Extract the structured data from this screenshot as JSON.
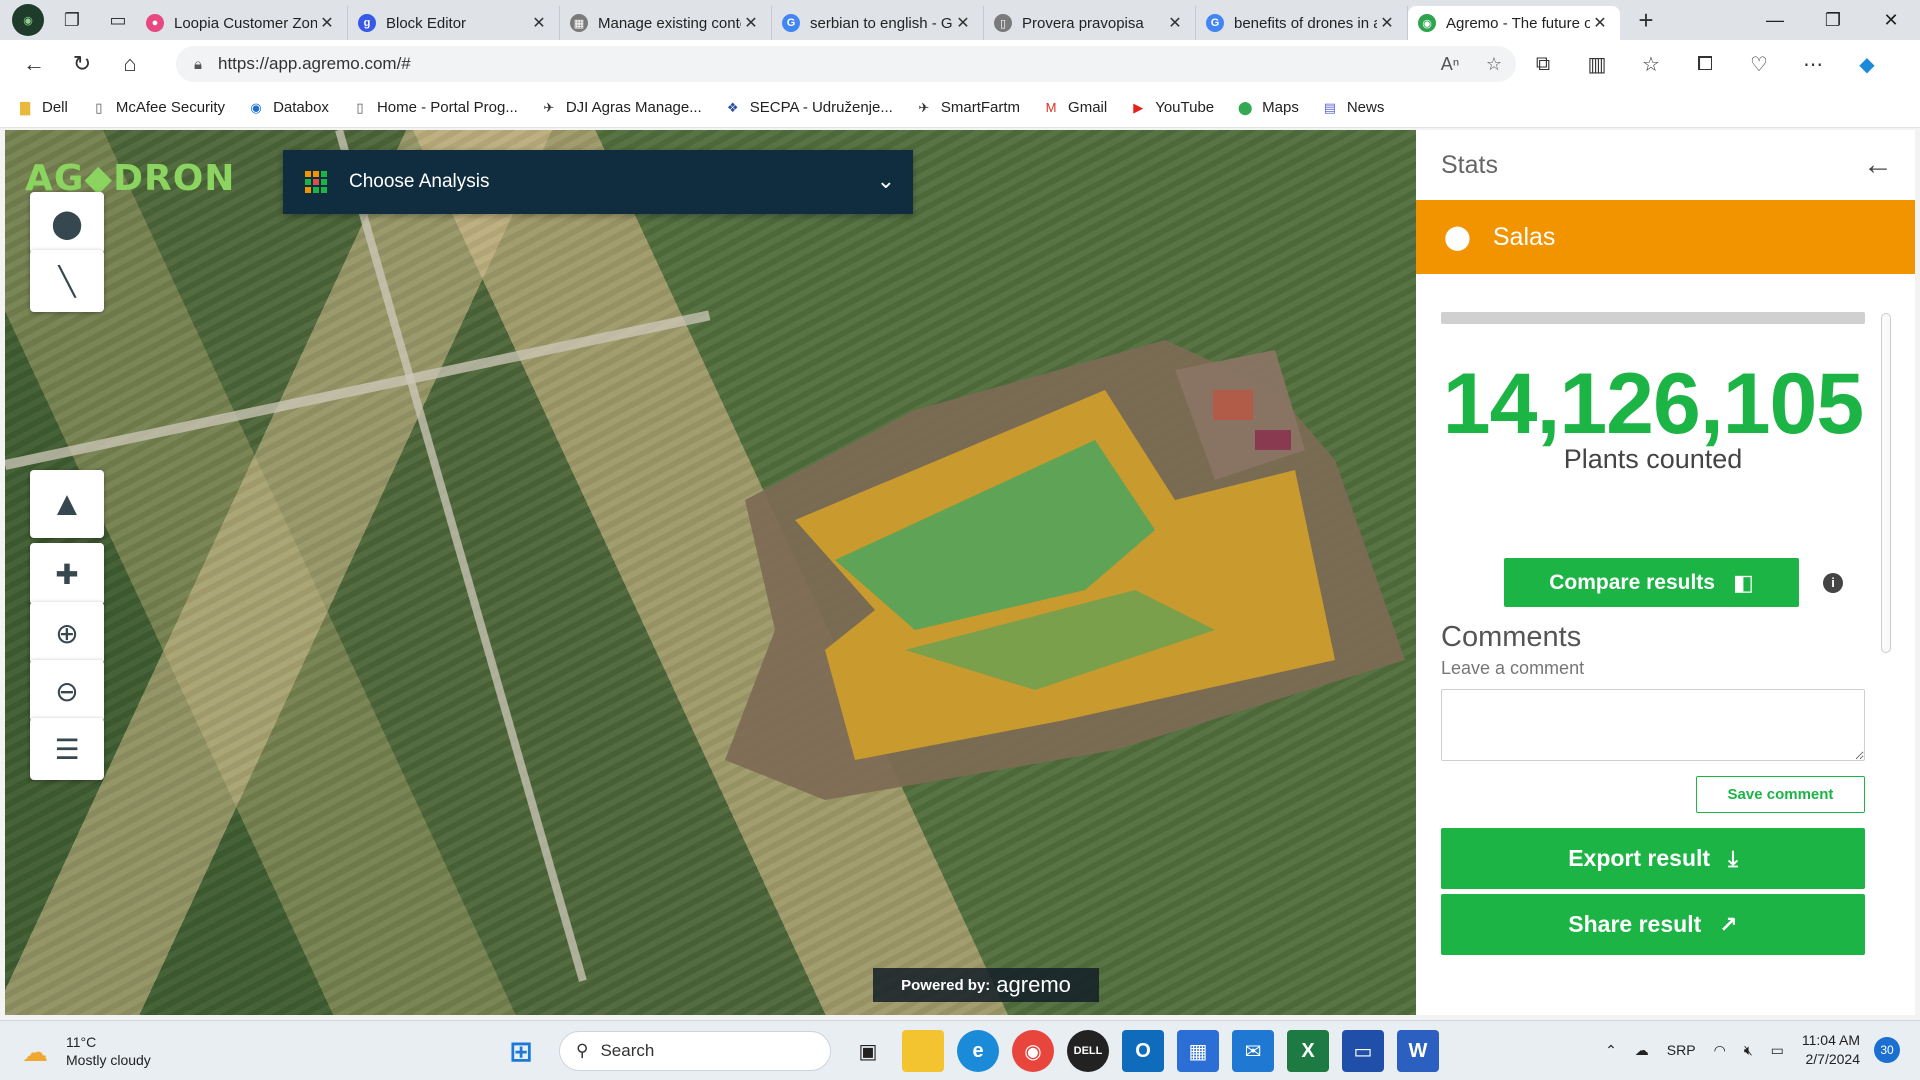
{
  "browser": {
    "tabs": [
      {
        "title": "Loopia Customer Zone",
        "color": "#e64980",
        "glyph": "●"
      },
      {
        "title": "Block Editor",
        "color": "#3858e9",
        "glyph": "g"
      },
      {
        "title": "Manage existing content",
        "color": "#7a7a7a",
        "glyph": "▦"
      },
      {
        "title": "serbian to english - Google Search",
        "color": "#4285f4",
        "glyph": "G"
      },
      {
        "title": "Provera pravopisa",
        "color": "#7a7a7a",
        "glyph": "▯"
      },
      {
        "title": "benefits of drones in agriculture",
        "color": "#4285f4",
        "glyph": "G"
      },
      {
        "title": "Agremo - The future of agriculture",
        "color": "#2ea44f",
        "glyph": "◉"
      }
    ],
    "url": "https://app.agremo.com/#",
    "bookmarks": [
      {
        "label": "Dell",
        "icon": "folder-icon"
      },
      {
        "label": "McAfee Security",
        "icon": "page-icon"
      },
      {
        "label": "Databox",
        "icon": "databox-icon"
      },
      {
        "label": "Home - Portal Prog...",
        "icon": "page-icon"
      },
      {
        "label": "DJI Agras Manage...",
        "icon": "dji-icon"
      },
      {
        "label": "SECPA - Udruženje...",
        "icon": "secpa-icon"
      },
      {
        "label": "SmartFartm",
        "icon": "dji-icon"
      },
      {
        "label": "Gmail",
        "icon": "gmail-icon"
      },
      {
        "label": "YouTube",
        "icon": "youtube-icon"
      },
      {
        "label": "Maps",
        "icon": "maps-icon"
      },
      {
        "label": "News",
        "icon": "news-icon"
      }
    ]
  },
  "app": {
    "logo": "AG◆DRON",
    "analysis_label": "Choose Analysis",
    "powered_by": "Powered by:",
    "powered_brand": "agremo"
  },
  "panel": {
    "title": "Stats",
    "location": "Salas",
    "plant_count": "14,126,105",
    "plant_count_label": "Plants counted",
    "compare_label": "Compare results",
    "comments_title": "Comments",
    "comments_sub": "Leave a comment",
    "save_label": "Save comment",
    "export_label": "Export result",
    "share_label": "Share result"
  },
  "taskbar": {
    "temp": "11°C",
    "weather": "Mostly cloudy",
    "search": "Search",
    "lang": "SRP",
    "time": "11:04 AM",
    "date": "2/7/2024",
    "notifications": "30"
  },
  "colors": {
    "accent_green": "#1db446",
    "location_orange": "#f29400",
    "analysis_bg": "#0f2d3e"
  }
}
